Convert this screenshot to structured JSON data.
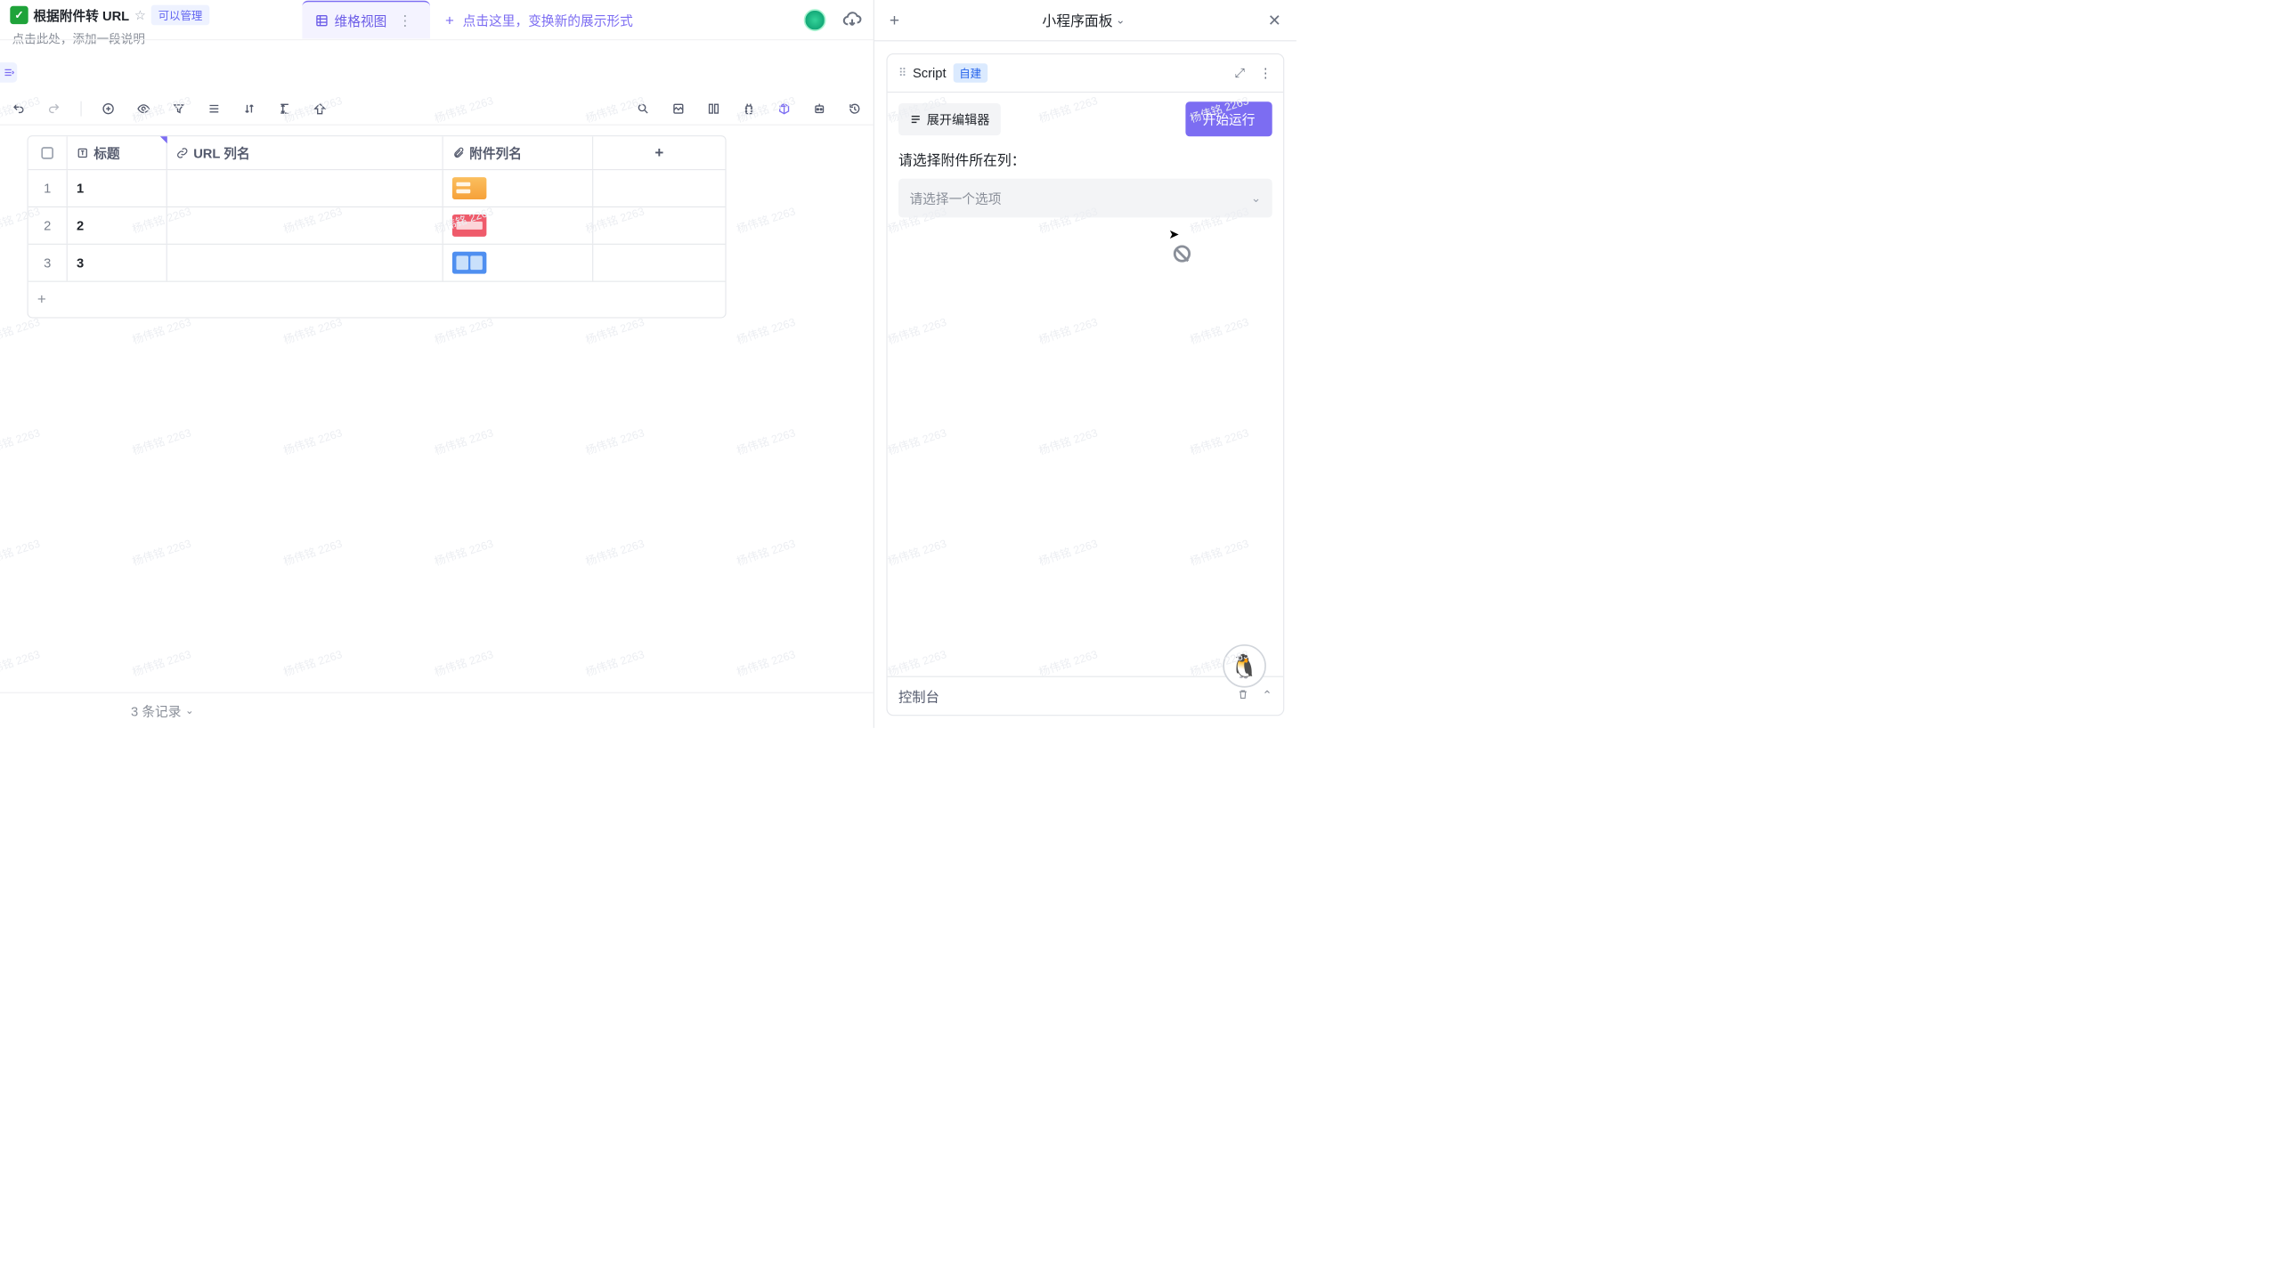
{
  "header": {
    "title": "根据附件转 URL",
    "badge": "可以管理",
    "description": "点击此处，添加一段说明"
  },
  "tabs": {
    "active": "维格视图",
    "hint": "点击这里，变换新的展示形式"
  },
  "columns": {
    "title": "标题",
    "url": "URL 列名",
    "attachment": "附件列名"
  },
  "rows": [
    {
      "num": "1",
      "title": "1",
      "thumb": "orange"
    },
    {
      "num": "2",
      "title": "2",
      "thumb": "red"
    },
    {
      "num": "3",
      "title": "3",
      "thumb": "blue"
    }
  ],
  "footer": {
    "count": "3 条记录"
  },
  "panel": {
    "title": "小程序面板",
    "script_name": "Script",
    "tag": "自建",
    "expand_label": "展开编辑器",
    "run_label": "开始运行",
    "form_label": "请选择附件所在列：",
    "select_placeholder": "请选择一个选项",
    "console": "控制台"
  },
  "watermark": "杨伟铭 2263"
}
